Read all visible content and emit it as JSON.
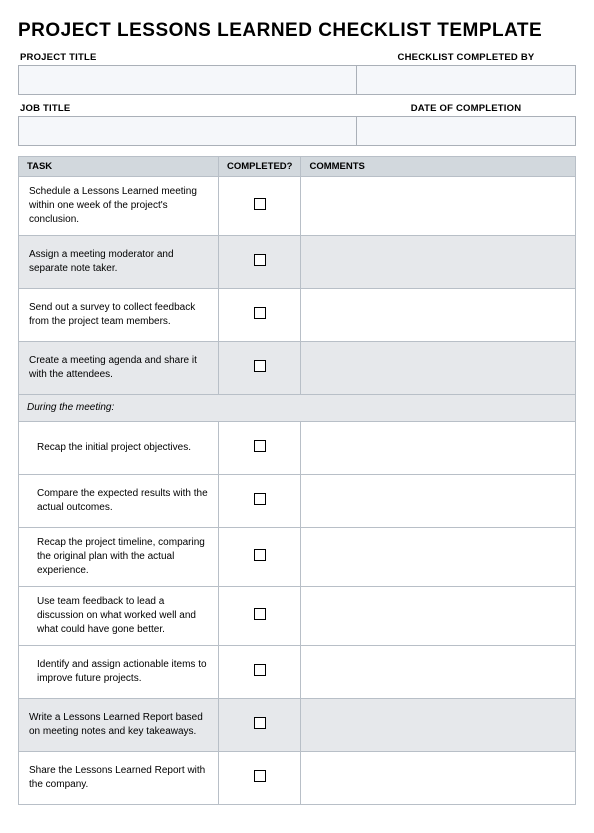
{
  "title": "PROJECT LESSONS LEARNED CHECKLIST TEMPLATE",
  "meta": {
    "project_title_label": "PROJECT TITLE",
    "project_title_value": "",
    "completed_by_label": "CHECKLIST COMPLETED BY",
    "completed_by_value": "",
    "job_title_label": "JOB TITLE",
    "job_title_value": "",
    "date_label": "DATE OF COMPLETION",
    "date_value": ""
  },
  "columns": {
    "task": "TASK",
    "completed": "COMPLETED?",
    "comments": "COMMENTS"
  },
  "section_label": "During the meeting:",
  "rows": [
    {
      "task": "Schedule a Lessons Learned meeting within one week of the project's conclusion.",
      "shaded": false,
      "indented": false,
      "comments": ""
    },
    {
      "task": "Assign a meeting moderator and separate note taker.",
      "shaded": true,
      "indented": false,
      "comments": ""
    },
    {
      "task": "Send out a survey to collect feedback from the project team members.",
      "shaded": false,
      "indented": false,
      "comments": ""
    },
    {
      "task": "Create a meeting agenda and share it with the attendees.",
      "shaded": true,
      "indented": false,
      "comments": ""
    }
  ],
  "rows2": [
    {
      "task": "Recap the initial project objectives.",
      "shaded": false,
      "indented": true,
      "comments": ""
    },
    {
      "task": "Compare the expected results with the actual outcomes.",
      "shaded": false,
      "indented": true,
      "comments": ""
    },
    {
      "task": "Recap the project timeline, comparing the original plan with the actual experience.",
      "shaded": false,
      "indented": true,
      "comments": ""
    },
    {
      "task": "Use team feedback to lead a discussion on what worked well and what could have gone better.",
      "shaded": false,
      "indented": true,
      "comments": ""
    },
    {
      "task": "Identify and assign actionable items to improve future projects.",
      "shaded": false,
      "indented": true,
      "comments": ""
    },
    {
      "task": "Write a Lessons Learned Report based on meeting notes and key takeaways.",
      "shaded": true,
      "indented": false,
      "comments": ""
    },
    {
      "task": "Share the Lessons Learned Report with the company.",
      "shaded": false,
      "indented": false,
      "comments": ""
    }
  ]
}
